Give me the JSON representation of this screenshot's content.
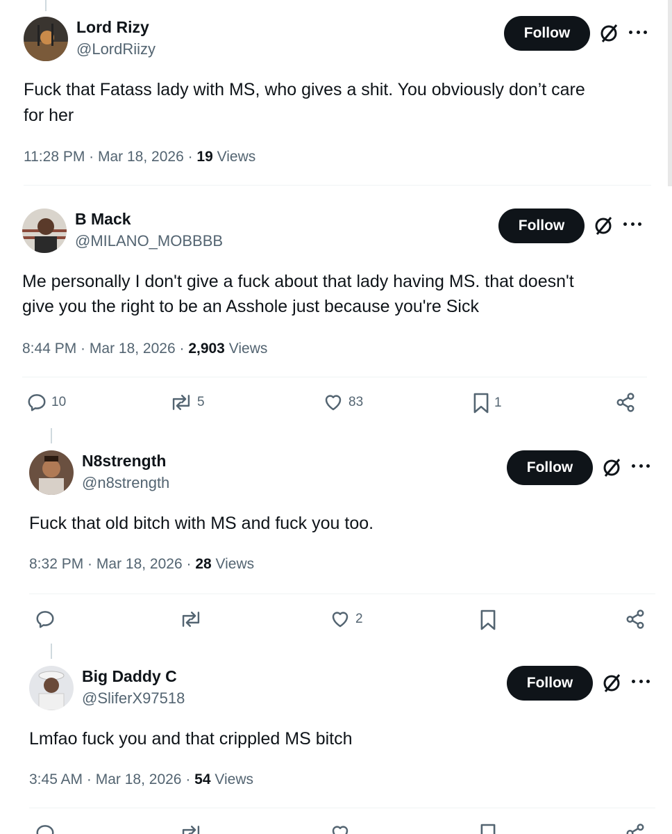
{
  "tweets": [
    {
      "display_name": "Lord Rizy",
      "handle": "@LordRiizy",
      "follow_label": "Follow",
      "text_lines": [
        "Fuck that Fatass lady with MS, who gives a shit. You obviously don’t care",
        "for her"
      ],
      "time": "11:28 PM",
      "date": "Mar 18, 2026",
      "views_count": "19",
      "views_label": "Views"
    },
    {
      "display_name": "B Mack",
      "handle": "@MILANO_MOBBBB",
      "follow_label": "Follow",
      "text_lines": [
        "Me personally I don't give a fuck about that lady having MS. that doesn't",
        "give you the right to be an Asshole just because you're Sick"
      ],
      "time": "8:44 PM",
      "date": "Mar 18, 2026",
      "views_count": "2,903",
      "views_label": "Views",
      "actions": {
        "replies": "10",
        "reposts": "5",
        "likes": "83",
        "bookmarks": "1"
      }
    },
    {
      "display_name": "N8strength",
      "handle": "@n8strength",
      "follow_label": "Follow",
      "text_lines": [
        "Fuck that old bitch with MS and fuck you too."
      ],
      "time": "8:32 PM",
      "date": "Mar 18, 2026",
      "views_count": "28",
      "views_label": "Views",
      "actions": {
        "replies": "",
        "reposts": "",
        "likes": "2",
        "bookmarks": ""
      }
    },
    {
      "display_name": "Big Daddy C",
      "handle": "@SliferX97518",
      "follow_label": "Follow",
      "text_lines": [
        "Lmfao fuck you and that crippled MS bitch"
      ],
      "time": "3:45 AM",
      "date": "Mar 18, 2026",
      "views_count": "54",
      "views_label": "Views"
    }
  ],
  "icons": {
    "grok": "grok-icon",
    "more": "more-icon",
    "reply": "reply-icon",
    "repost": "repost-icon",
    "like": "heart-icon",
    "bookmark": "bookmark-icon",
    "share": "share-icon"
  },
  "colors": {
    "text": "#0f1419",
    "secondary": "#536471",
    "follow_bg": "#0f1419",
    "divider": "#eff3f4",
    "thread_line": "#cfd9de"
  }
}
